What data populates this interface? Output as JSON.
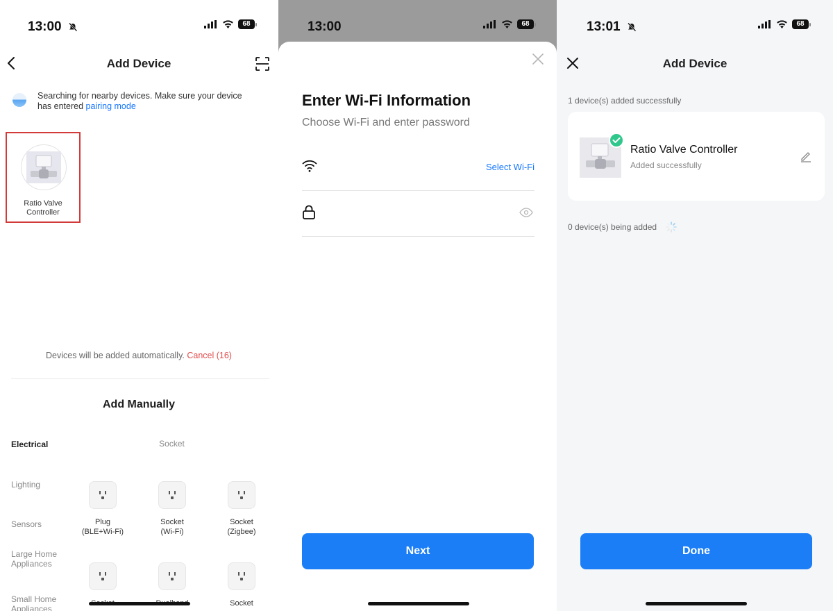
{
  "panel1": {
    "status": {
      "time": "13:00",
      "battery": "68"
    },
    "nav": {
      "title": "Add Device"
    },
    "search": {
      "text": "Searching for nearby devices. Make sure your device has entered",
      "link": "pairing mode"
    },
    "found_device": {
      "name": "Ratio Valve Controller"
    },
    "auto_text": "Devices will be added automatically.",
    "cancel_label": "Cancel (16)",
    "manual_title": "Add Manually",
    "categories": [
      "Electrical",
      "Lighting",
      "Sensors",
      "Large Home Appliances",
      "Small Home Appliances"
    ],
    "section_title": "Socket",
    "items": [
      {
        "label_line1": "Plug",
        "label_line2": "(BLE+Wi-Fi)"
      },
      {
        "label_line1": "Socket",
        "label_line2": "(Wi-Fi)"
      },
      {
        "label_line1": "Socket",
        "label_line2": "(Zigbee)"
      },
      {
        "label_line1": "Socket",
        "label_line2": ""
      },
      {
        "label_line1": "Dualband",
        "label_line2": ""
      },
      {
        "label_line1": "Socket",
        "label_line2": ""
      }
    ]
  },
  "panel2": {
    "status": {
      "time": "13:00",
      "battery": "68"
    },
    "title": "Enter Wi-Fi Information",
    "subtitle": "Choose Wi-Fi and enter password",
    "select_wifi": "Select Wi-Fi",
    "next_button": "Next"
  },
  "panel3": {
    "status": {
      "time": "13:01",
      "battery": "68"
    },
    "nav": {
      "title": "Add Device"
    },
    "added_count": "1 device(s) added successfully",
    "device": {
      "name": "Ratio Valve Controller",
      "status": "Added successfully"
    },
    "being_added": "0 device(s) being added",
    "done_button": "Done"
  },
  "colors": {
    "accent": "#1b7ef6",
    "link": "#1677ff",
    "cancel": "#e24a4a",
    "success": "#2fc78b",
    "highlight_border": "#d23a3a"
  },
  "icons": [
    "back-icon",
    "scan-icon",
    "bell-off-icon",
    "signal-icon",
    "wifi-icon",
    "battery-icon",
    "close-icon",
    "lock-icon",
    "eye-icon",
    "edit-icon",
    "check-icon",
    "loading-icon",
    "socket-icon",
    "valve-icon"
  ]
}
